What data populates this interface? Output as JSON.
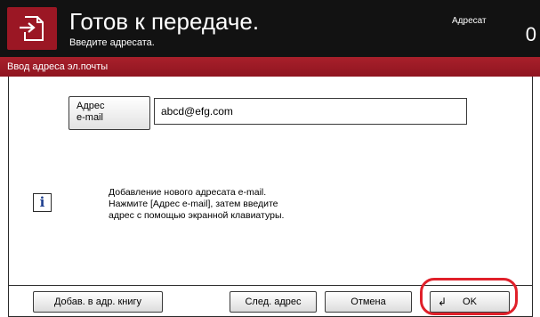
{
  "header": {
    "title": "Готов к передаче.",
    "subtitle": "Введите адресата.",
    "destination_label": "Адресат",
    "destination_count": "0",
    "icon": "send-document-icon"
  },
  "panel": {
    "title": "Ввод адреса эл.почты",
    "address_button": {
      "line1": "Адрес",
      "line2": "e-mail"
    },
    "email_value": "abcd@efg.com",
    "info_icon": "info-icon",
    "info_lines": [
      "Добавление нового адресата e-mail.",
      "Нажмите [Адрес e-mail], затем введите",
      "адрес с помощью экранной клавиатуры."
    ]
  },
  "toolbar": {
    "add_to_book": "Добав. в адр. книгу",
    "next_address": "След. адрес",
    "cancel": "Отмена",
    "ok": "OK",
    "ok_icon": "return-arrow-icon"
  },
  "colors": {
    "header_bg": "#121212",
    "accent_red": "#9b1724",
    "highlight_ring": "#e0202a"
  }
}
